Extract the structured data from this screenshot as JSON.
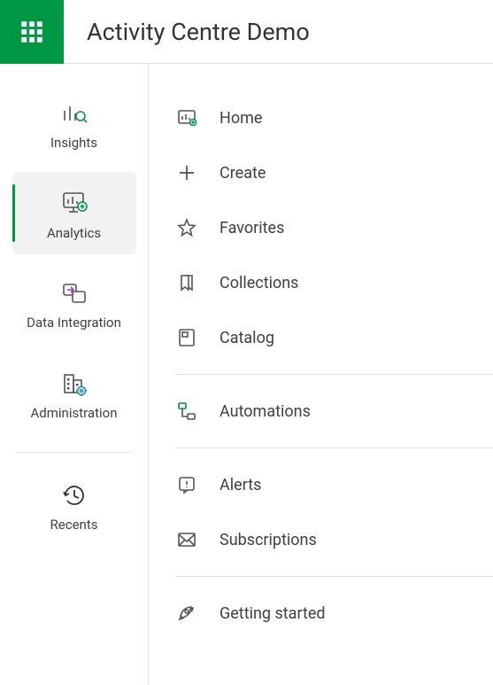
{
  "header": {
    "title": "Activity Centre Demo"
  },
  "sidebar": {
    "items": [
      {
        "label": "Insights",
        "active": false
      },
      {
        "label": "Analytics",
        "active": true
      },
      {
        "label": "Data Integration",
        "active": false
      },
      {
        "label": "Administration",
        "active": false
      }
    ],
    "recents": {
      "label": "Recents"
    }
  },
  "menu": {
    "groups": [
      [
        {
          "label": "Home"
        },
        {
          "label": "Create"
        },
        {
          "label": "Favorites"
        },
        {
          "label": "Collections"
        },
        {
          "label": "Catalog"
        }
      ],
      [
        {
          "label": "Automations"
        }
      ],
      [
        {
          "label": "Alerts"
        },
        {
          "label": "Subscriptions"
        }
      ],
      [
        {
          "label": "Getting started"
        }
      ]
    ]
  }
}
